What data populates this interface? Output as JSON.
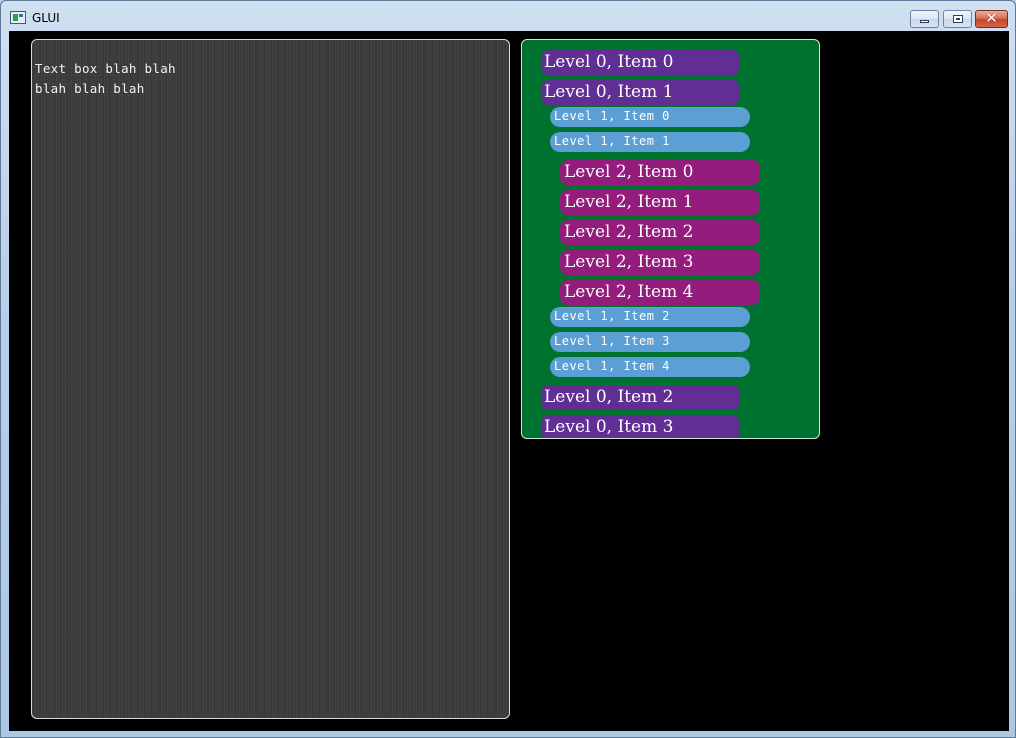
{
  "window": {
    "title": "GLUI",
    "controls": {
      "minimize_icon": "minimize-icon",
      "maximize_icon": "maximize-icon",
      "close_icon": "close-icon",
      "close_glyph": "✕"
    }
  },
  "textbox": {
    "lines": [
      "Text box blah blah",
      "blah blah blah"
    ],
    "background": "#3d3d3d"
  },
  "tree": {
    "background": "#007230",
    "colors": {
      "level0": "#612f93",
      "level1": "#5b9fd4",
      "level2": "#931c7d"
    },
    "items": [
      {
        "level": 0,
        "label": "Level 0, Item 0"
      },
      {
        "level": 0,
        "label": "Level 0, Item 1"
      },
      {
        "level": 1,
        "label": "Level 1, Item 0"
      },
      {
        "level": 1,
        "label": "Level 1, Item 1"
      },
      {
        "level": 2,
        "label": "Level 2, Item 0"
      },
      {
        "level": 2,
        "label": "Level 2, Item 1"
      },
      {
        "level": 2,
        "label": "Level 2, Item 2"
      },
      {
        "level": 2,
        "label": "Level 2, Item 3"
      },
      {
        "level": 2,
        "label": "Level 2, Item 4"
      },
      {
        "level": 1,
        "label": "Level 1, Item 2"
      },
      {
        "level": 1,
        "label": "Level 1, Item 3"
      },
      {
        "level": 1,
        "label": "Level 1, Item 4"
      },
      {
        "level": 0,
        "label": "Level 0, Item 2"
      },
      {
        "level": 0,
        "label": "Level 0, Item 3"
      }
    ]
  }
}
